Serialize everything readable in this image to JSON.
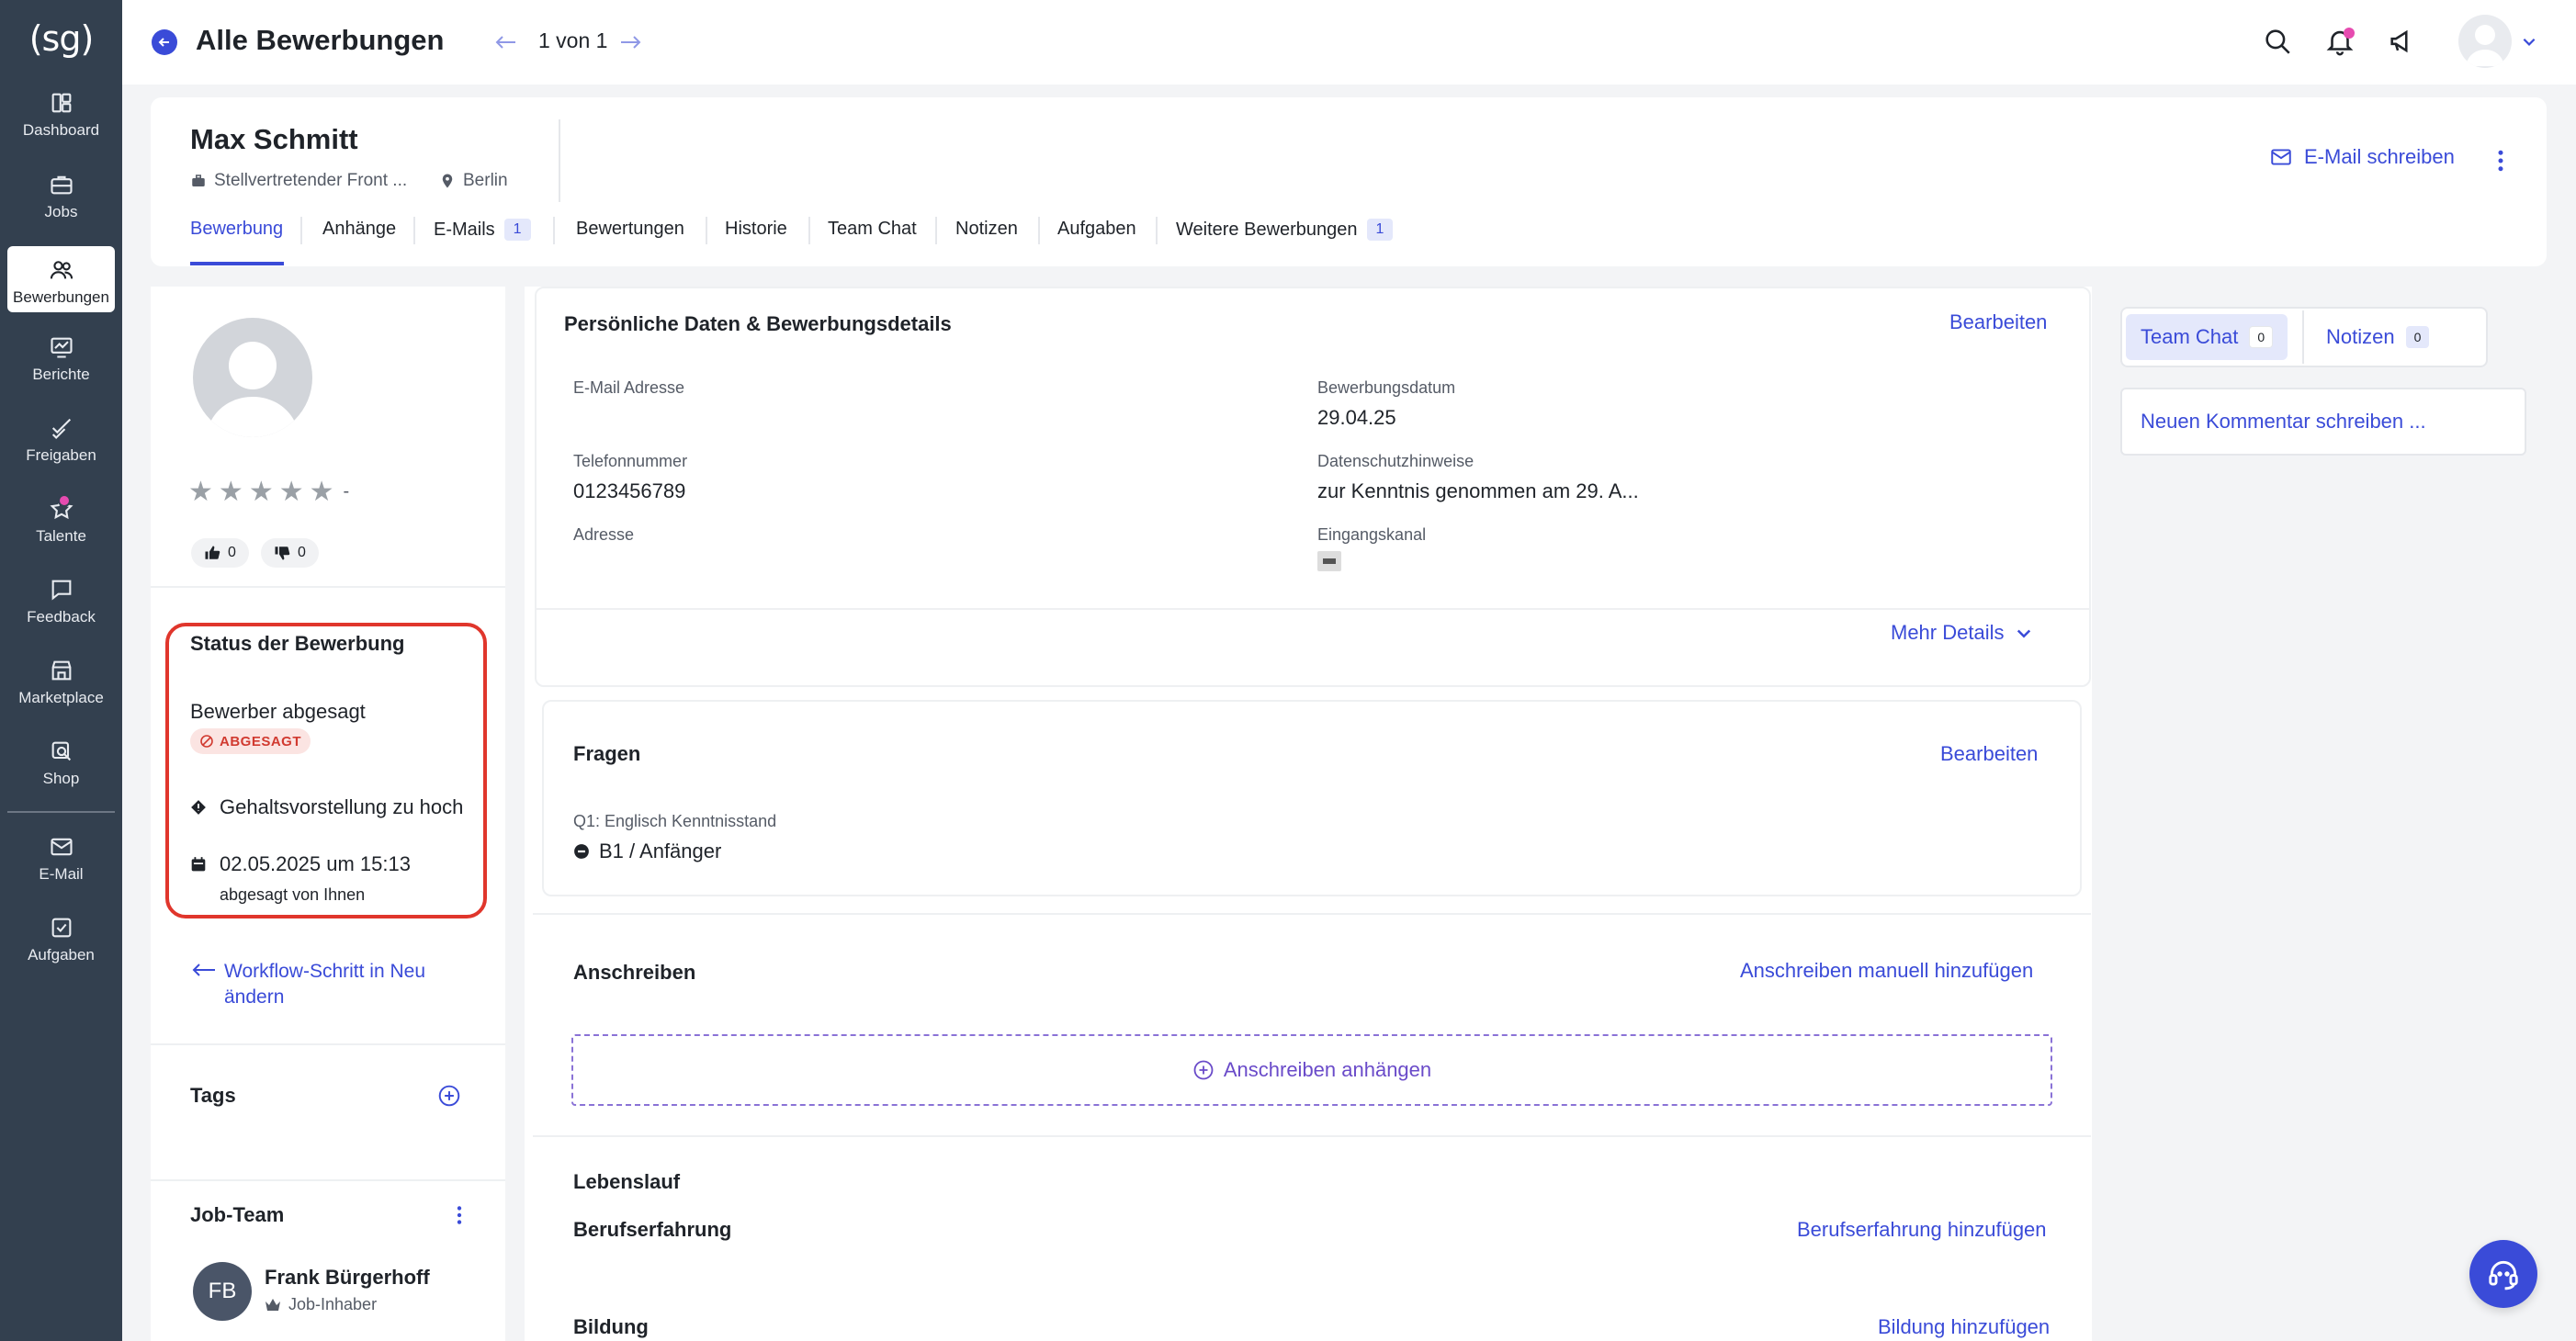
{
  "app": {
    "logo_text": "(sg)"
  },
  "sidebar": {
    "items": [
      {
        "label": "Dashboard",
        "icon": "dashboard-icon"
      },
      {
        "label": "Jobs",
        "icon": "briefcase-icon"
      },
      {
        "label": "Bewerbungen",
        "icon": "users-icon",
        "active": true
      },
      {
        "label": "Berichte",
        "icon": "chart-icon"
      },
      {
        "label": "Freigaben",
        "icon": "approval-icon"
      },
      {
        "label": "Talente",
        "icon": "star-icon",
        "has_dot": true
      },
      {
        "label": "Feedback",
        "icon": "feedback-icon"
      },
      {
        "label": "Marketplace",
        "icon": "store-icon"
      },
      {
        "label": "Shop",
        "icon": "shop-icon"
      },
      {
        "label": "E-Mail",
        "icon": "mail-icon"
      },
      {
        "label": "Aufgaben",
        "icon": "tasks-icon"
      }
    ]
  },
  "topbar": {
    "title": "Alle Bewerbungen",
    "pager": "1 von 1"
  },
  "candidate": {
    "name": "Max Schmitt",
    "position": "Stellvertretender Front ...",
    "location": "Berlin",
    "email_action": "E-Mail schreiben"
  },
  "tabs": [
    {
      "label": "Bewerbung",
      "active": true
    },
    {
      "label": "Anhänge"
    },
    {
      "label": "E-Mails",
      "badge": "1"
    },
    {
      "label": "Bewertungen"
    },
    {
      "label": "Historie"
    },
    {
      "label": "Team Chat"
    },
    {
      "label": "Notizen"
    },
    {
      "label": "Aufgaben"
    },
    {
      "label": "Weitere Bewerbungen",
      "badge": "1"
    }
  ],
  "profile": {
    "rating_text": "-",
    "rating_value": 0,
    "thumbs_up": "0",
    "thumbs_down": "0"
  },
  "status": {
    "title": "Status der Bewerbung",
    "text": "Bewerber abgesagt",
    "badge": "ABGESAGT",
    "reason": "Gehaltsvorstellung zu hoch",
    "date": "02.05.2025 um 15:13",
    "by": "abgesagt von Ihnen",
    "colors": {
      "border": "#e0362c",
      "badge_bg": "#fbe4e2",
      "badge_text": "#d13a30"
    }
  },
  "workflow": {
    "line1": "Workflow-Schritt in Neu",
    "line2": "ändern"
  },
  "tags": {
    "title": "Tags"
  },
  "job_team": {
    "title": "Job-Team",
    "member": {
      "initials": "FB",
      "name": "Frank Bürgerhoff",
      "role": "Job-Inhaber"
    }
  },
  "details": {
    "title": "Persönliche Daten & Bewerbungsdetails",
    "edit": "Bearbeiten",
    "fields": {
      "email_label": "E-Mail Adresse",
      "email_value": "",
      "phone_label": "Telefonnummer",
      "phone_value": "0123456789",
      "address_label": "Adresse",
      "address_value": "",
      "date_label": "Bewerbungsdatum",
      "date_value": "29.04.25",
      "privacy_label": "Datenschutzhinweise",
      "privacy_value": "zur Kenntnis genommen am 29. A...",
      "channel_label": "Eingangskanal"
    },
    "more": "Mehr Details"
  },
  "questions": {
    "title": "Fragen",
    "edit": "Bearbeiten",
    "q1_label": "Q1: Englisch Kenntnisstand",
    "q1_value": "B1 / Anfänger"
  },
  "cover_letter": {
    "title": "Anschreiben",
    "add_manual": "Anschreiben manuell hinzufügen",
    "attach": "Anschreiben anhängen"
  },
  "cv": {
    "title": "Lebenslauf",
    "experience_title": "Berufserfahrung",
    "experience_add": "Berufserfahrung hinzufügen",
    "education_title": "Bildung",
    "education_add": "Bildung hinzufügen"
  },
  "right_panel": {
    "tabs": [
      {
        "label": "Team Chat",
        "badge": "0",
        "active": true
      },
      {
        "label": "Notizen",
        "badge": "0"
      }
    ],
    "comment_placeholder": "Neuen Kommentar schreiben ..."
  },
  "colors": {
    "accent": "#3a4bd8",
    "sidebar_bg": "#33404f",
    "notification_dot": "#e64bb0"
  }
}
